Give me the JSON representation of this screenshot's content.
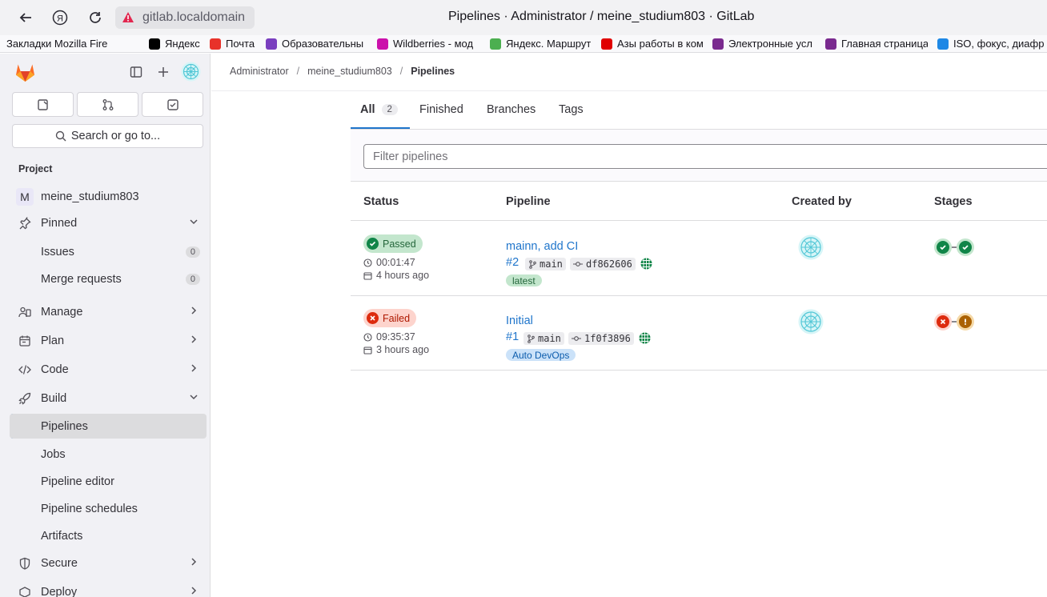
{
  "browser": {
    "url": "gitlab.localdomain",
    "window_title": "Pipelines · Administrator / meine_studium803 · GitLab",
    "bookmarks": [
      {
        "label": "Закладки Mozilla Fire",
        "color": "#ffffff"
      },
      {
        "label": "Яндекс",
        "color": "#000000"
      },
      {
        "label": "Почта",
        "color": "#e8322a"
      },
      {
        "label": "Образовательны",
        "color": "#7a3fbf"
      },
      {
        "label": "Wildberries - мод",
        "color": "#cb11ab"
      },
      {
        "label": "Яндекс. Маршрут",
        "color": "#4caf50"
      },
      {
        "label": "Азы работы в ком",
        "color": "#e00000"
      },
      {
        "label": "Электронные усл",
        "color": "#7a2a8f"
      },
      {
        "label": "Главная страница",
        "color": "#7a2a8f"
      },
      {
        "label": "ISO, фокус, диафр",
        "color": "#1e88e5"
      }
    ]
  },
  "sidebar": {
    "search_label": "Search or go to...",
    "section_label": "Project",
    "project_initial": "M",
    "project_name": "meine_studium803",
    "pinned_label": "Pinned",
    "pinned_items": [
      {
        "label": "Issues",
        "count": "0"
      },
      {
        "label": "Merge requests",
        "count": "0"
      }
    ],
    "groups": {
      "manage": "Manage",
      "plan": "Plan",
      "code": "Code",
      "build": "Build",
      "secure": "Secure",
      "deploy": "Deploy"
    },
    "build_items": [
      "Pipelines",
      "Jobs",
      "Pipeline editor",
      "Pipeline schedules",
      "Artifacts"
    ]
  },
  "breadcrumb": [
    "Administrator",
    "meine_studium803",
    "Pipelines"
  ],
  "tabs": {
    "all_label": "All",
    "all_count": "2",
    "finished_label": "Finished",
    "branches_label": "Branches",
    "tags_label": "Tags"
  },
  "filter": {
    "placeholder": "Filter pipelines"
  },
  "table": {
    "headers": {
      "status": "Status",
      "pipeline": "Pipeline",
      "created_by": "Created by",
      "stages": "Stages"
    },
    "rows": [
      {
        "status": "Passed",
        "duration": "00:01:47",
        "finished": "4 hours ago",
        "title": "mainn, add CI",
        "id": "#2",
        "branch": "main",
        "commit": "df862606",
        "label": "latest",
        "stages": [
          "success",
          "success"
        ]
      },
      {
        "status": "Failed",
        "duration": "09:35:37",
        "finished": "3 hours ago",
        "title": "Initial",
        "id": "#1",
        "branch": "main",
        "commit": "1f0f3896",
        "label": "Auto DevOps",
        "stages": [
          "failed",
          "warning"
        ]
      }
    ]
  },
  "colors": {
    "accent": "#1f75cb",
    "success": "#108548",
    "failed": "#dd2b0e",
    "warning": "#ab6100"
  }
}
